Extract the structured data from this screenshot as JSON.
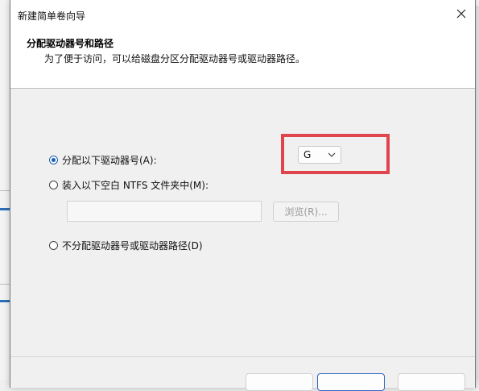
{
  "dialog": {
    "title": "新建简单卷向导",
    "close_icon": "close-icon",
    "header": {
      "title": "分配驱动器号和路径",
      "subtitle": "为了便于访问，可以给磁盘分区分配驱动器号或驱动器路径。"
    },
    "options": {
      "assign_letter_label": "分配以下驱动器号(A):",
      "mount_folder_label": "装入以下空白 NTFS 文件夹中(M):",
      "no_assign_label": "不分配驱动器号或驱动器路径(D)"
    },
    "drive_letter": {
      "selected": "G",
      "dropdown_icon": "chevron-down-icon"
    },
    "folder_path": {
      "value": ""
    },
    "browse_label": "浏览(R)...",
    "footer": {
      "buttons": [
        "",
        "",
        ""
      ]
    }
  },
  "colors": {
    "highlight": "#e0444d",
    "radio_selected": "#1a5fb4"
  }
}
